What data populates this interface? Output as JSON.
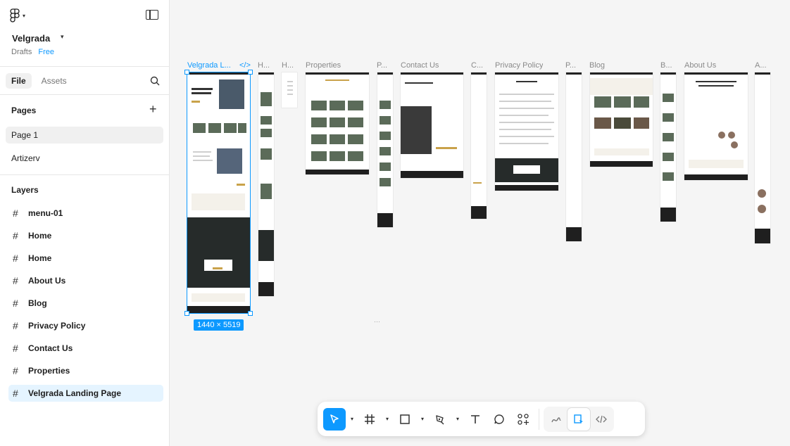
{
  "sidebar": {
    "project_name": "Velgrada",
    "drafts_label": "Drafts",
    "plan_label": "Free",
    "tabs": {
      "file": "File",
      "assets": "Assets"
    },
    "pages_title": "Pages",
    "pages": [
      "Page 1",
      "Artizerv"
    ],
    "layers_title": "Layers",
    "layers": [
      "menu-01",
      "Home",
      "Home",
      "About Us",
      "Blog",
      "Privacy Policy",
      "Contact Us",
      "Properties",
      "Velgrada Landing Page"
    ]
  },
  "canvas": {
    "frames": {
      "landing": "Velgrada L...",
      "h1": "H...",
      "h2": "H...",
      "properties": "Properties",
      "p1": "P...",
      "contact": "Contact Us",
      "c1": "C...",
      "privacy": "Privacy Policy",
      "p2": "P...",
      "blog": "Blog",
      "b1": "B...",
      "about": "About Us",
      "a1": "A..."
    },
    "selection_size": "1440 × 5519"
  },
  "colors": {
    "accent": "#0d99ff",
    "gold": "#c9a24a"
  }
}
